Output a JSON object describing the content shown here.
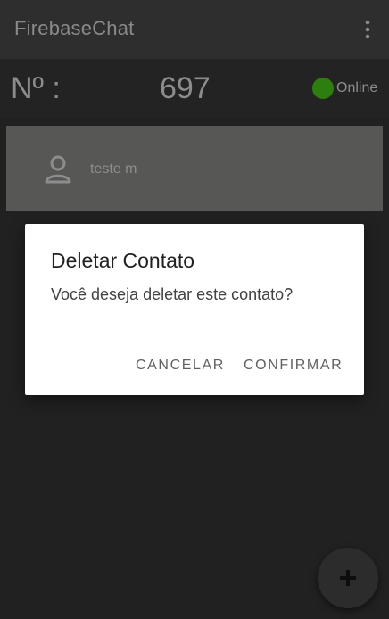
{
  "app_bar": {
    "title": "FirebaseChat",
    "menu_icon": "more-vert-icon"
  },
  "status": {
    "number_label": "Nº :",
    "number_value": "697",
    "online_label": "Online",
    "online_color": "#2e7d0f"
  },
  "contacts": [
    {
      "name": "teste m",
      "icon": "person-outline-icon"
    }
  ],
  "dialog": {
    "title": "Deletar Contato",
    "message": "Você deseja deletar este contato?",
    "cancel_label": "CANCELAR",
    "confirm_label": "CONFIRMAR"
  },
  "fab": {
    "icon": "plus-icon"
  },
  "colors": {
    "background": "#212121",
    "app_bar": "#2e2e2e",
    "contact_card": "#575756",
    "dialog": "#ffffff"
  }
}
